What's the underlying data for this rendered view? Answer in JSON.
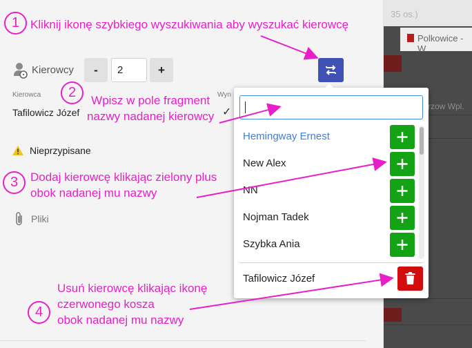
{
  "background": {
    "top_right_text": "35 os.)",
    "right_chip_text": "Polkowice - W",
    "right_row_text": "rzow Wpl."
  },
  "drivers": {
    "label": "Kierowcy",
    "minus_label": "-",
    "count": "2",
    "plus_label": "+"
  },
  "table": {
    "col_driver": "Kierowca",
    "col_partial": "Wyn",
    "driver_name": "Tafilowicz Józef",
    "check": "✓"
  },
  "sections": {
    "unassigned": "Nieprzypisane",
    "files": "Pliki"
  },
  "popup": {
    "search_value": "",
    "results": [
      {
        "name": "Hemingway Ernest",
        "highlight": true
      },
      {
        "name": "New Alex"
      },
      {
        "name": "NN"
      },
      {
        "name": "Nojman Tadek"
      },
      {
        "name": "Szybka Ania"
      }
    ],
    "assigned": "Tafilowicz Józef"
  },
  "annotations": {
    "step1": {
      "num": "1",
      "text": "Kliknij ikonę szybkiego wyszukiwania aby wyszukać kierowcę"
    },
    "step2": {
      "num": "2",
      "text": "Wpisz w pole fragment\nnazwy nadanej kierowcy"
    },
    "step3": {
      "num": "3",
      "text": "Dodaj kierowcę klikając zielony plus\nobok nadanej mu nazwy"
    },
    "step4": {
      "num": "4",
      "text": "Usuń kierowcę klikając ikonę\nczerwonego kosza\nobok nadanej mu nazwy"
    }
  },
  "colors": {
    "annotation": "#e81fc9",
    "primary_button": "#3f51b5",
    "add_button": "#14a314",
    "delete_button": "#d10d0d",
    "highlight_text": "#3f7fd6"
  },
  "icons": [
    "driver-icon",
    "swap-icon",
    "check-icon",
    "warning-icon",
    "paperclip-icon",
    "plus-icon",
    "trash-icon"
  ]
}
